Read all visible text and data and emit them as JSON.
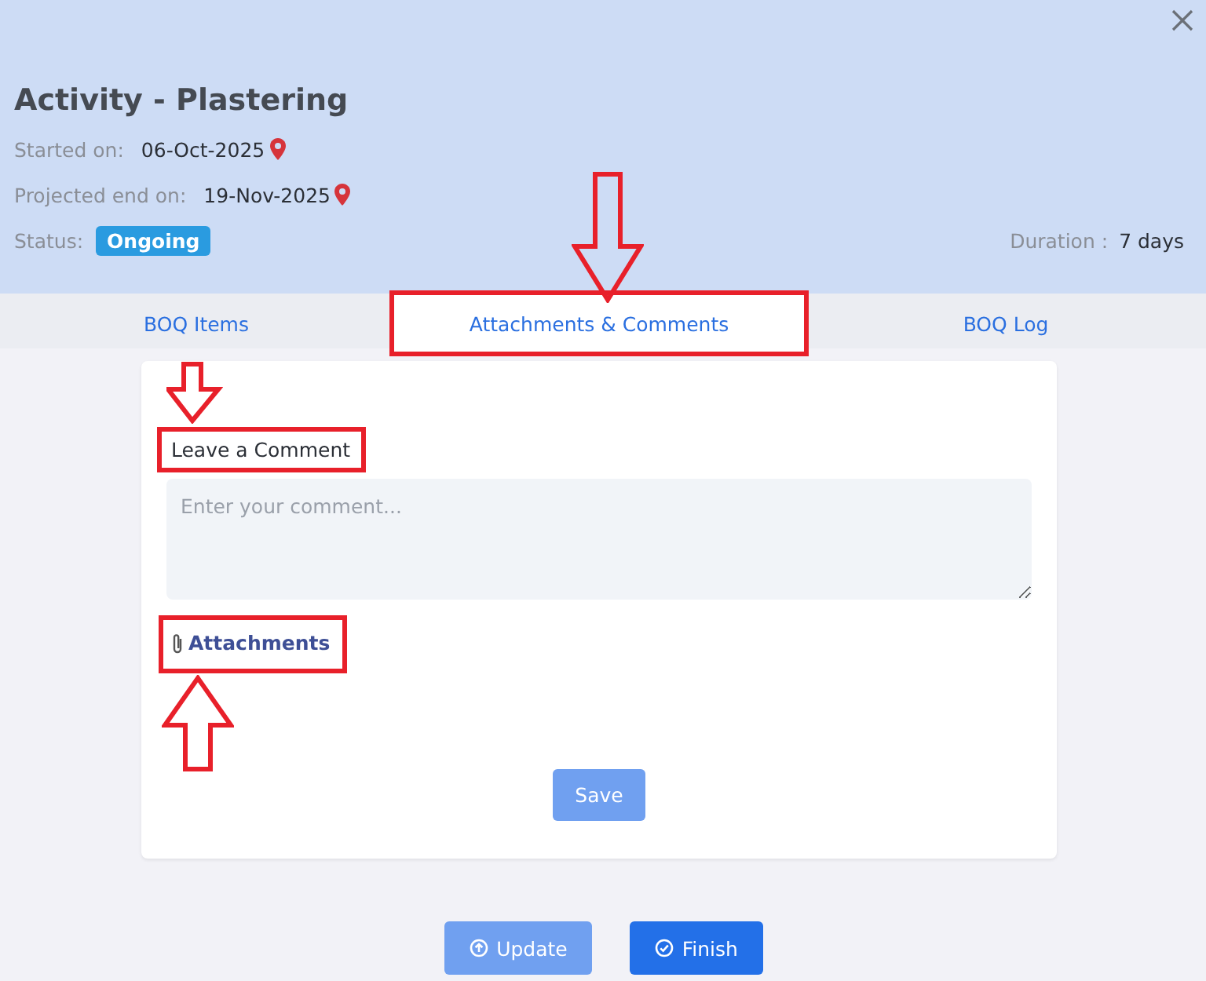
{
  "header": {
    "title": "Activity - Plastering",
    "fields": [
      {
        "label": "Started on:",
        "value": "06-Oct-2025",
        "location_pin": true
      },
      {
        "label": "Projected end on:",
        "value": "19-Nov-2025",
        "location_pin": true
      }
    ],
    "status": {
      "label": "Status:",
      "badge": "Ongoing"
    },
    "duration": {
      "label": "Duration :",
      "value": "7 days"
    }
  },
  "tabs": [
    {
      "label": "BOQ Items",
      "selected": false,
      "highlighted": false,
      "arrow_above": false
    },
    {
      "label": "Attachments & Comments",
      "selected": true,
      "highlighted": true,
      "arrow_above": true
    },
    {
      "label": "BOQ Log",
      "selected": false,
      "highlighted": false,
      "arrow_above": false
    }
  ],
  "comment": {
    "label": "Leave a Comment",
    "highlighted": true,
    "arrow_above": true,
    "placeholder": "Enter your comment..."
  },
  "attachments": {
    "label": "Attachments",
    "highlighted": true,
    "arrow_below": true
  },
  "save_button": {
    "label": "Save",
    "disabled": true
  },
  "footer_buttons": [
    {
      "label": "Update",
      "kind": "update",
      "disabled": true
    },
    {
      "label": "Finish",
      "kind": "finish",
      "disabled": false
    }
  ]
}
